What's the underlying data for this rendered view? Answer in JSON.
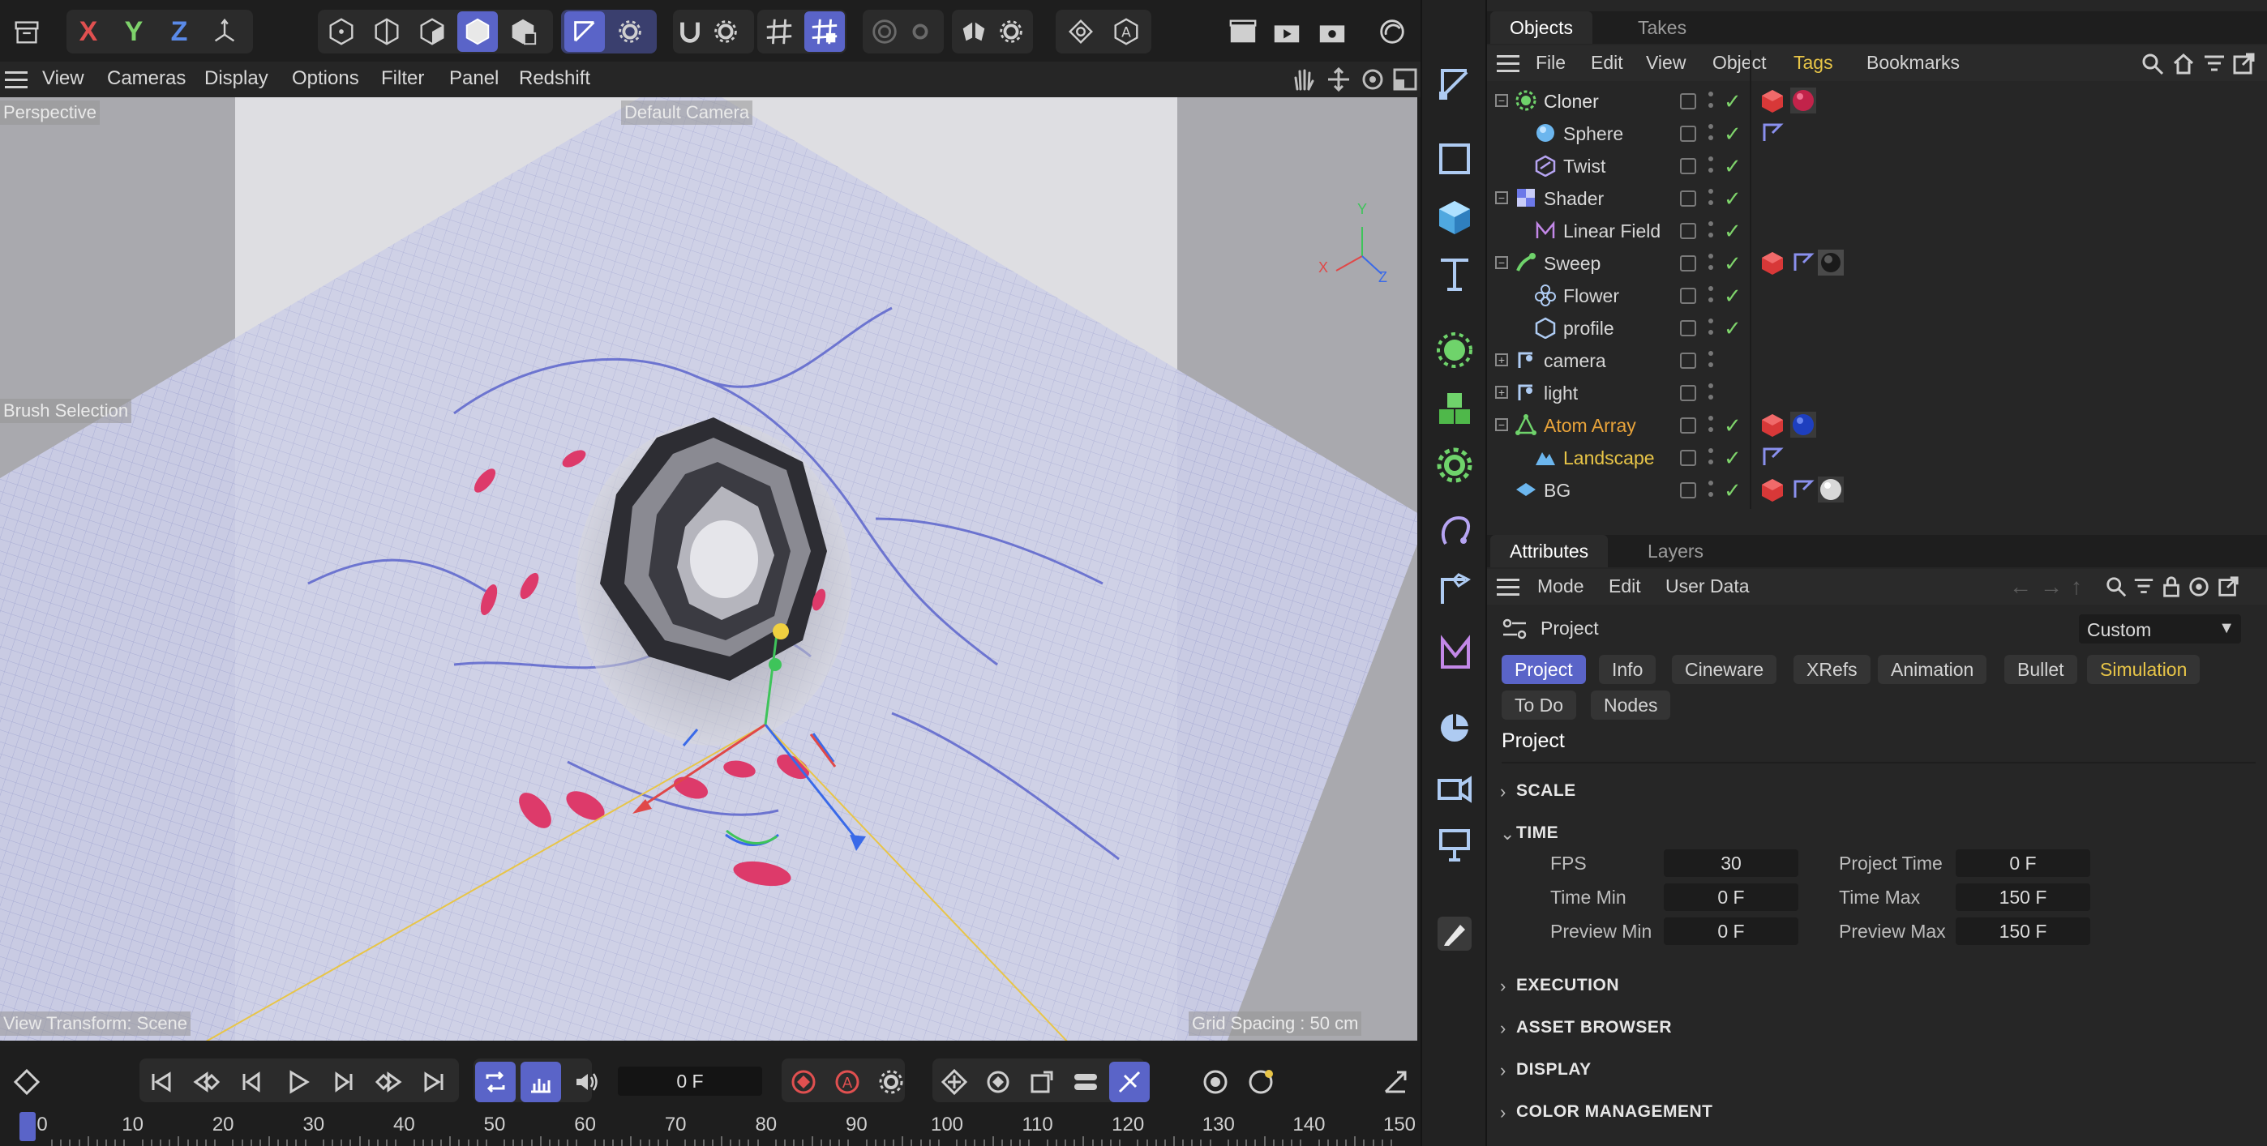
{
  "axes": {
    "x": "X",
    "y": "Y",
    "z": "Z"
  },
  "viewport_menu": [
    "View",
    "Cameras",
    "Display",
    "Options",
    "Filter",
    "Panel",
    "Redshift"
  ],
  "viewport": {
    "perspective_label": "Perspective",
    "camera_label": "Default Camera",
    "brush_label": "Brush Selection",
    "view_transform": "View Transform: Scene",
    "grid_spacing": "Grid Spacing : 50 cm",
    "gizmo_x": "X",
    "gizmo_y": "Y",
    "gizmo_z": "Z"
  },
  "objects_panel": {
    "tabs": [
      "Objects",
      "Takes"
    ],
    "menu": [
      "File",
      "Edit",
      "View",
      "Object",
      "Tags",
      "Bookmarks"
    ],
    "rows": [
      {
        "name": "Cloner",
        "icon": "cloner-icon",
        "color": "#e0e0e0"
      },
      {
        "name": "Sphere",
        "icon": "sphere-icon",
        "color": "#d6d6d6"
      },
      {
        "name": "Twist",
        "icon": "twist-icon",
        "color": "#d6d6d6"
      },
      {
        "name": "Shader",
        "icon": "shader-icon",
        "color": "#d6d6d6"
      },
      {
        "name": "Linear Field",
        "icon": "linear-field-icon",
        "color": "#d6d6d6"
      },
      {
        "name": "Sweep",
        "icon": "sweep-icon",
        "color": "#d6d6d6"
      },
      {
        "name": "Flower",
        "icon": "flower-icon",
        "color": "#d6d6d6"
      },
      {
        "name": "profile",
        "icon": "spline-icon",
        "color": "#d6d6d6"
      },
      {
        "name": "camera",
        "icon": "null-icon",
        "color": "#d6d6d6"
      },
      {
        "name": "light",
        "icon": "null-icon",
        "color": "#d6d6d6"
      },
      {
        "name": "Atom Array",
        "icon": "atom-array-icon",
        "color": "#e8a33a"
      },
      {
        "name": "Landscape",
        "icon": "landscape-icon",
        "color": "#e8c547"
      },
      {
        "name": "BG",
        "icon": "background-icon",
        "color": "#d6d6d6"
      }
    ]
  },
  "attributes_panel": {
    "tabs": [
      "Attributes",
      "Layers"
    ],
    "menu": [
      "Mode",
      "Edit",
      "User Data"
    ],
    "project_label": "Project",
    "dropdown_value": "Custom",
    "chips_row1": [
      "Project",
      "Info",
      "Cineware",
      "XRefs",
      "Animation",
      "Bullet",
      "Simulation"
    ],
    "chips_row2": [
      "To Do",
      "Nodes"
    ],
    "section_title": "Project",
    "sections": {
      "scale": "SCALE",
      "time": "TIME",
      "execution": "EXECUTION",
      "asset_browser": "ASSET BROWSER",
      "display": "DISPLAY",
      "color_management": "COLOR MANAGEMENT"
    },
    "time_fields": {
      "fps_label": "FPS",
      "fps_value": "30",
      "project_time_label": "Project Time",
      "project_time_value": "0 F",
      "time_min_label": "Time Min",
      "time_min_value": "0 F",
      "time_max_label": "Time Max",
      "time_max_value": "150 F",
      "preview_min_label": "Preview Min",
      "preview_min_value": "0 F",
      "preview_max_label": "Preview Max",
      "preview_max_value": "150 F"
    }
  },
  "timeline": {
    "current_frame": "0 F",
    "ticks": [
      "0",
      "10",
      "20",
      "30",
      "40",
      "50",
      "60",
      "70",
      "80",
      "90",
      "100",
      "110",
      "120",
      "130",
      "140",
      "150"
    ]
  },
  "colors": {
    "accent": "#5a64c8",
    "tag_highlight": "#e8c547",
    "check_green": "#7ed36b"
  }
}
